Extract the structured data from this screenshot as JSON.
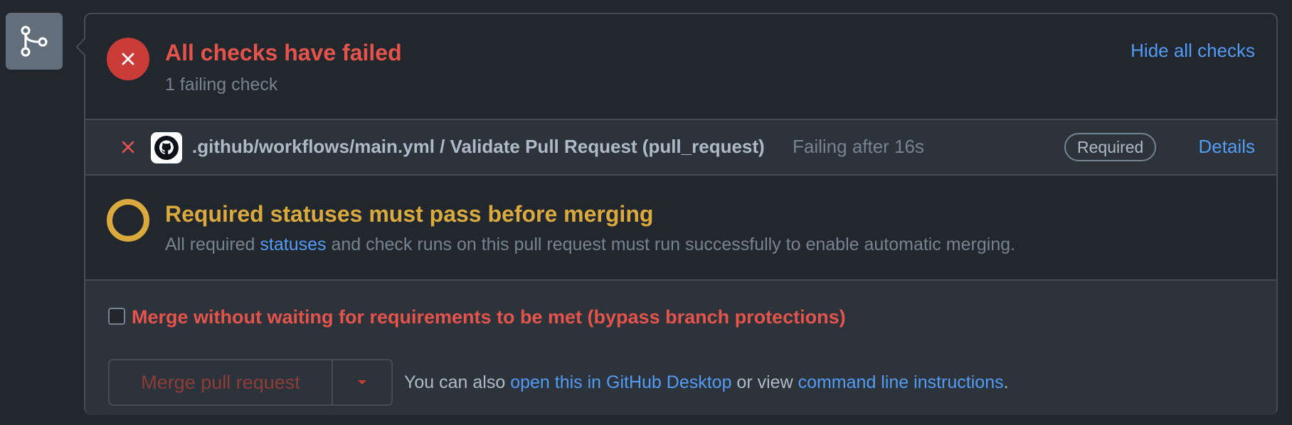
{
  "colors": {
    "background": "#22272e",
    "panel_alt": "#2d333b",
    "border": "#444c56",
    "danger": "#e5534b",
    "danger_fill": "#c93c37",
    "warning": "#daaa3f",
    "link": "#539bf5",
    "muted": "#768390",
    "text": "#adbac7"
  },
  "timeline_icon": "git-branch-icon",
  "checks_header": {
    "icon": "x-circle-icon",
    "title": "All checks have failed",
    "subtitle": "1 failing check",
    "toggle_label": "Hide all checks"
  },
  "check_row": {
    "status_icon": "x-icon",
    "app_icon": "github-logo-icon",
    "name": ".github/workflows/main.yml / Validate Pull Request (pull_request)",
    "meta": "Failing after 16s",
    "badge": "Required",
    "details_label": "Details"
  },
  "requirements": {
    "icon": "pending-ring-icon",
    "title": "Required statuses must pass before merging",
    "desc_before": "All required ",
    "desc_link": "statuses",
    "desc_after": " and check runs on this pull request must run successfully to enable automatic merging."
  },
  "merge": {
    "bypass_checked": false,
    "bypass_label": "Merge without waiting for requirements to be met (bypass branch protections)",
    "button_label": "Merge pull request",
    "caret_icon": "triangle-down-icon",
    "also_prefix": "You can also ",
    "desktop_link": "open this in GitHub Desktop",
    "also_middle": " or view ",
    "cli_link": "command line instructions",
    "also_suffix": "."
  }
}
